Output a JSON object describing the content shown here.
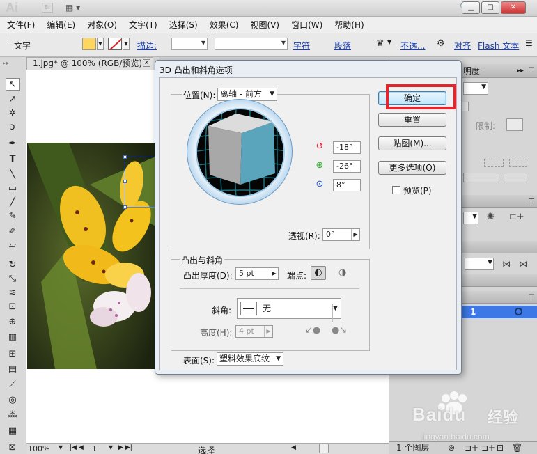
{
  "app": {
    "logo": "Ai",
    "bridge": "Br"
  },
  "menu": [
    "文件(F)",
    "编辑(E)",
    "对象(O)",
    "文字(T)",
    "选择(S)",
    "效果(C)",
    "视图(V)",
    "窗口(W)",
    "帮助(H)"
  ],
  "control_bar": {
    "tool_label": "文字",
    "stroke_label": "描边:",
    "char_link": "字符",
    "para_link": "段落",
    "opacity_link": "不透...",
    "align_link": "对齐",
    "flash_link": "Flash 文本"
  },
  "document": {
    "tab_title": "1.jpg* @ 100% (RGB/预览)",
    "close": "x"
  },
  "status_bar": {
    "zoom": "100%",
    "page": "1",
    "mode": "选择"
  },
  "right_panel": {
    "transparency_header": "明度",
    "limit_label": "限制:",
    "layer_name": "1",
    "layers_count": "1 个图层"
  },
  "dialog": {
    "title": "3D 凸出和斜角选项",
    "position_label": "位置(N):",
    "position_value": "离轴 - 前方",
    "rot_x": "-18°",
    "rot_y": "-26°",
    "rot_z": "8°",
    "perspective_label": "透视(R):",
    "perspective_value": "0°",
    "extrude_group": "凸出与斜角",
    "depth_label": "凸出厚度(D):",
    "depth_value": "5 pt",
    "cap_label": "端点:",
    "bevel_label": "斜角:",
    "bevel_value": "无",
    "height_label": "高度(H):",
    "height_value": "4 pt",
    "surface_label": "表面(S):",
    "surface_value": "塑料效果底纹",
    "buttons": {
      "ok": "确定",
      "reset": "重置",
      "map": "贴图(M)...",
      "more": "更多选项(O)",
      "preview": "预览(P)"
    }
  },
  "watermark": {
    "brand": "Baidu",
    "sub": "经验",
    "url": "jingyan.baidu.com"
  },
  "colors": {
    "fill": "#ffd760",
    "highlight": "#e8232b",
    "accent": "#3c78e6",
    "cube_front": "#5aa4bc"
  }
}
